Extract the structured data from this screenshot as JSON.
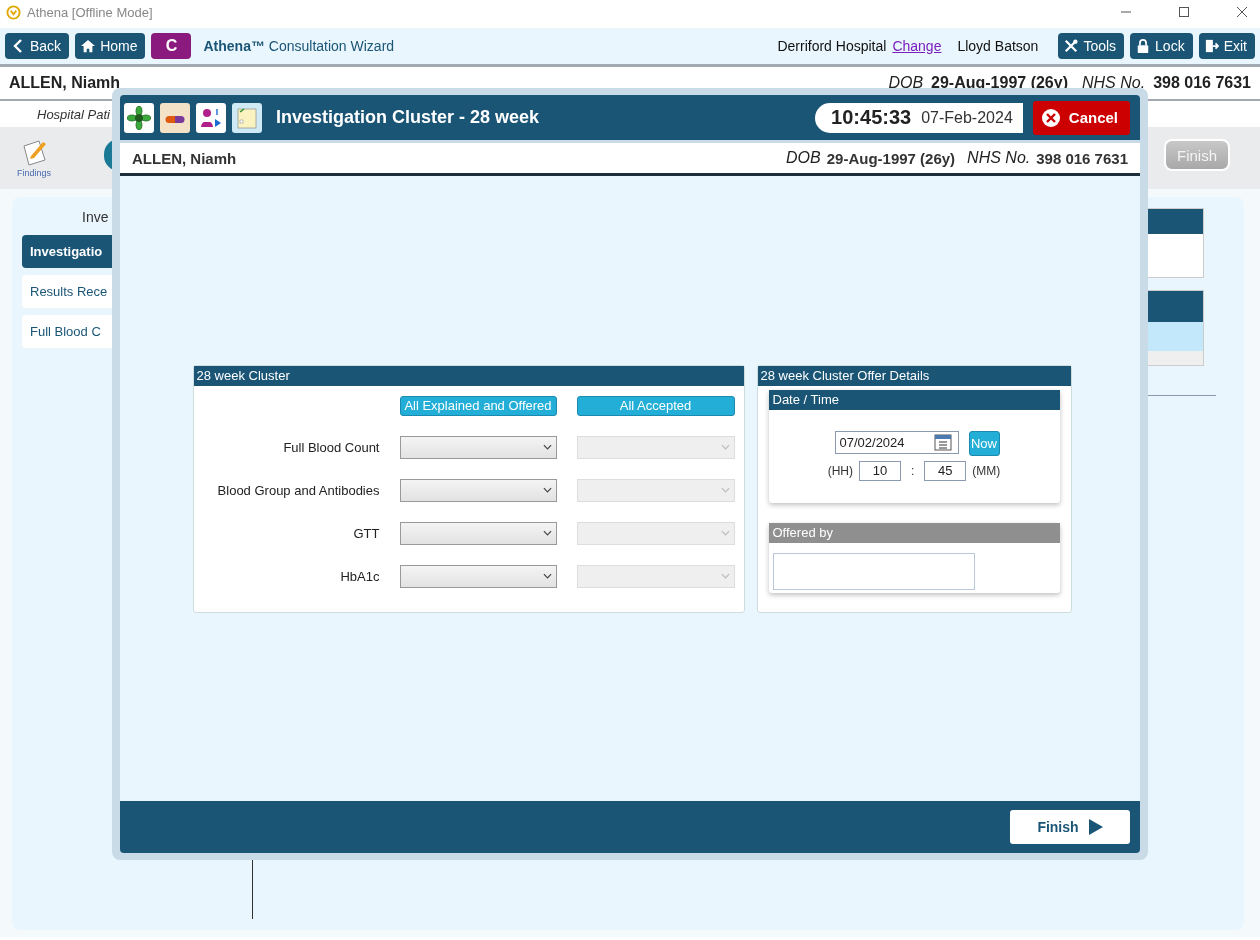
{
  "window": {
    "title": "Athena [Offline Mode]"
  },
  "toolbar": {
    "left_buttons": [
      {
        "label": "Back",
        "kind": "back"
      },
      {
        "label": "Home",
        "kind": "home"
      }
    ],
    "mode_badge": "C",
    "app_title": "**Athena™** Consultation Wizard",
    "hospital": "Derriford Hospital",
    "change_link": "Change",
    "user": "Lloyd Batson",
    "right_buttons": [
      {
        "label": "Tools",
        "kind": "tools"
      },
      {
        "label": "Lock",
        "kind": "lock"
      },
      {
        "label": "Exit",
        "kind": "exit"
      }
    ]
  },
  "patient": {
    "name": "ALLEN, Niamh",
    "dob_label": "DOB",
    "dob": "29-Aug-1997 (26y)",
    "nhs_label": "NHS No.",
    "nhs": "398 016 7631"
  },
  "subheader": "Hospital Pati",
  "findings": {
    "label": "Findings"
  },
  "background_finish": {
    "label": "Finish",
    "disabled": true
  },
  "sidebar": {
    "heading": "Inve",
    "items": [
      {
        "label": "Investigatio",
        "selected": true
      },
      {
        "label": "Results Rece",
        "selected": false
      },
      {
        "label": "Full Blood C",
        "selected": false
      }
    ]
  },
  "dialog": {
    "title": "Investigation Cluster - 28 week",
    "time": "10:45:33",
    "date": "07-Feb-2024",
    "cancel": "Cancel",
    "patient": {
      "name": "ALLEN, Niamh",
      "dob_label": "DOB",
      "dob": "29-Aug-1997 (26y)",
      "nhs_label": "NHS No.",
      "nhs": "398 016 7631"
    },
    "cluster": {
      "title": "28 week Cluster",
      "offered_button": "All Explained and Offered",
      "accepted_button": "All Accepted",
      "rows": [
        {
          "label": "Full Blood Count",
          "offered_disabled": false,
          "accepted_disabled": true
        },
        {
          "label": "Blood Group and Antibodies",
          "offered_disabled": false,
          "accepted_disabled": true
        },
        {
          "label": "GTT",
          "offered_disabled": false,
          "accepted_disabled": true
        },
        {
          "label": "HbA1c",
          "offered_disabled": false,
          "accepted_disabled": true
        }
      ]
    },
    "offer": {
      "title": "28 week Cluster Offer Details",
      "date_time": {
        "title": "Date / Time",
        "date": "07/02/2024",
        "now": "Now",
        "hh_label": "(HH)",
        "hh": "10",
        "separator": ":",
        "mm": "45",
        "mm_label": "(MM)"
      },
      "offered_by": {
        "title": "Offered by",
        "disabled": true
      }
    },
    "finish": "Finish"
  }
}
